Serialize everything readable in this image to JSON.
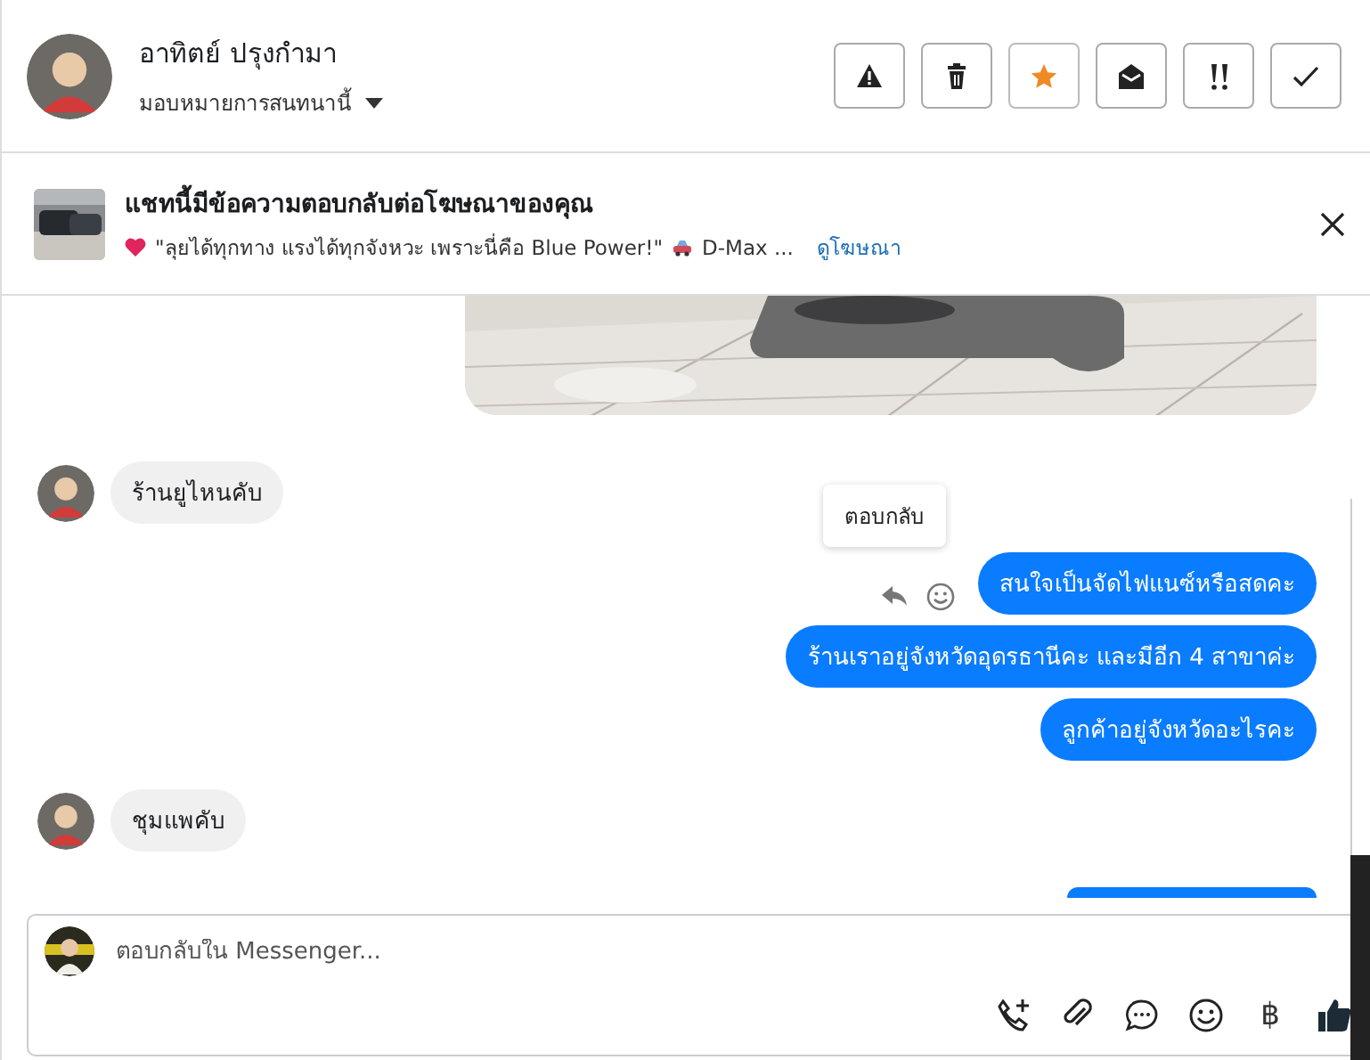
{
  "header": {
    "name": "อาทิตย์ ปรุงกำมา",
    "assign_label": "มอบหมายการสนทนานี้",
    "actions": [
      {
        "kind": "spam",
        "on": false
      },
      {
        "kind": "delete",
        "on": false
      },
      {
        "kind": "star",
        "on": true
      },
      {
        "kind": "unread",
        "on": false
      },
      {
        "kind": "priority",
        "on": false
      },
      {
        "kind": "done",
        "on": false
      }
    ]
  },
  "ad_banner": {
    "title": "แชทนี้มีข้อความตอบกลับต่อโฆษณาของคุณ",
    "text": "\"ลุยได้ทุกทาง แรงได้ทุกจังหวะ เพราะนี่คือ Blue Power!\"",
    "text_2": "D-Max ...",
    "link": "ดูโฆษณา"
  },
  "messages": [
    {
      "outgoing": true,
      "kind": "picture"
    },
    {
      "outgoing": false,
      "kind": "text",
      "text": "ร้านยูไหนคับ"
    },
    {
      "outgoing": true,
      "kind": "text",
      "text": "สนใจเป็นจัดไฟแนซ์หรือสดคะ",
      "hovered": true
    },
    {
      "outgoing": true,
      "kind": "text",
      "text": "ร้านเราอยู่จังหวัดอุดรธานีคะ และมีอีก 4 สาขาค่ะ"
    },
    {
      "outgoing": true,
      "kind": "text",
      "text": "ลูกค้าอยู่จังหวัดอะไรคะ"
    },
    {
      "outgoing": false,
      "kind": "text",
      "text": "ชุมแพคับ"
    },
    {
      "outgoing": true,
      "kind": "clipped"
    }
  ],
  "tooltip": "ตอบกลับ",
  "composer": {
    "placeholder": "ตอบกลับใน Messenger...",
    "tools": [
      {
        "kind": "call"
      },
      {
        "kind": "attach"
      },
      {
        "kind": "saved_reply"
      },
      {
        "kind": "emoji"
      },
      {
        "kind": "currency",
        "glyph": "฿"
      },
      {
        "kind": "like"
      }
    ]
  }
}
